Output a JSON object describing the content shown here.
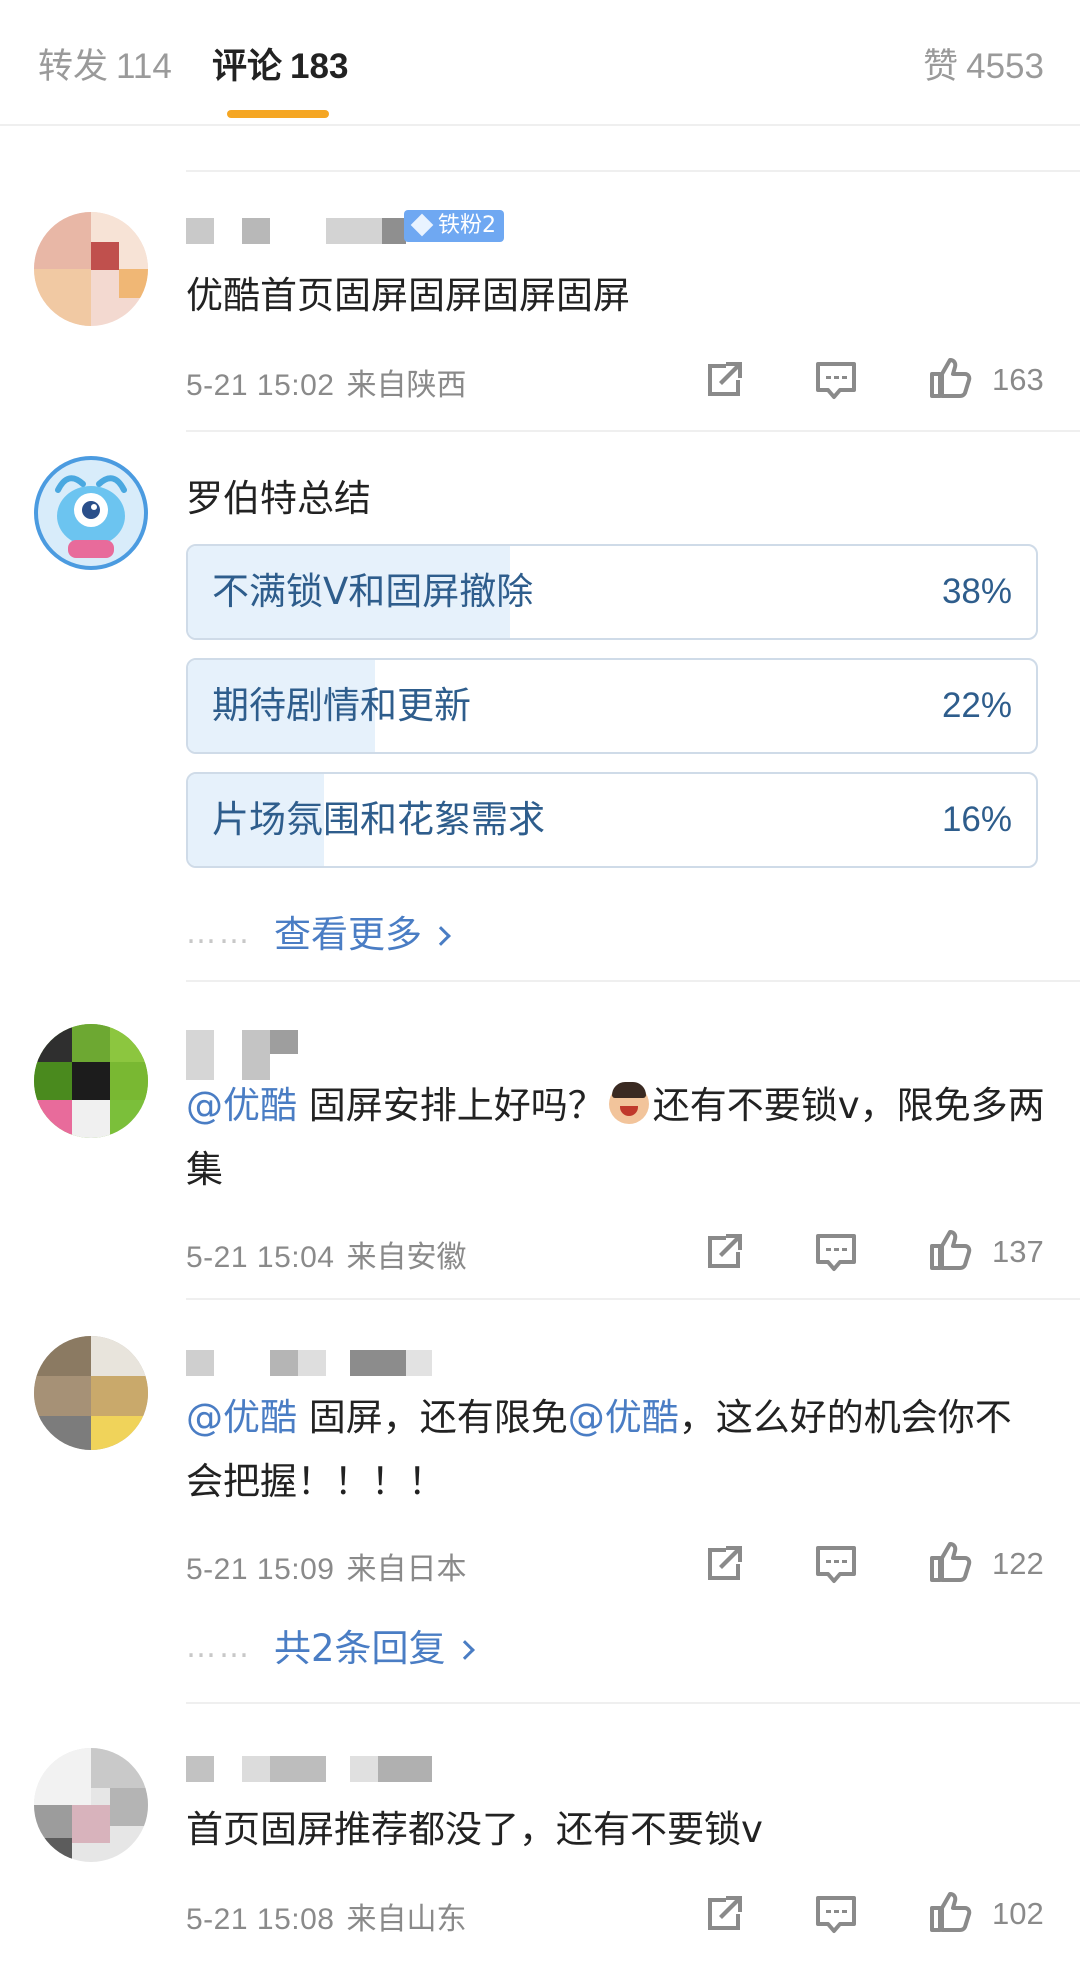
{
  "tabs": {
    "repost": {
      "label": "转发",
      "count": "114"
    },
    "comments": {
      "label": "评论",
      "count": "183"
    },
    "likes": {
      "label": "赞",
      "count": "4553"
    }
  },
  "colors": {
    "accent": "#f5a623",
    "link": "#4a7dc4",
    "badge": "#6fa8f2"
  },
  "comments": [
    {
      "badge": "铁粉2",
      "text": "优酷首页固屏固屏固屏固屏",
      "time": "5-21 15:02",
      "location": "来自陕西",
      "likes": "163"
    },
    {
      "mention_1": "@优酷",
      "text_1": " 固屏安排上好吗？",
      "text_2": "还有不要锁v，限免多两集",
      "time": "5-21 15:04",
      "location": "来自安徽",
      "likes": "137"
    },
    {
      "mention_1": "@优酷",
      "text_1": " 固屏，还有限免",
      "mention_2": "@优酷",
      "text_2": "，这么好的机会你不会把握！！！！",
      "time": "5-21 15:09",
      "location": "来自日本",
      "likes": "122",
      "replies": "共2条回复"
    },
    {
      "text": "首页固屏推荐都没了，还有不要锁v",
      "time": "5-21 15:08",
      "location": "来自山东",
      "likes": "102"
    }
  ],
  "poll": {
    "author": "罗伯特总结",
    "options": [
      {
        "label": "不满锁V和固屏撤除",
        "percent": "38%",
        "value": 0.38
      },
      {
        "label": "期待剧情和更新",
        "percent": "22%",
        "value": 0.22
      },
      {
        "label": "片场氛围和花絮需求",
        "percent": "16%",
        "value": 0.16
      }
    ],
    "more": "查看更多",
    "dots": "……"
  },
  "icons": {
    "share": "share-icon",
    "reply": "comment-icon",
    "like": "thumbs-up-icon"
  }
}
